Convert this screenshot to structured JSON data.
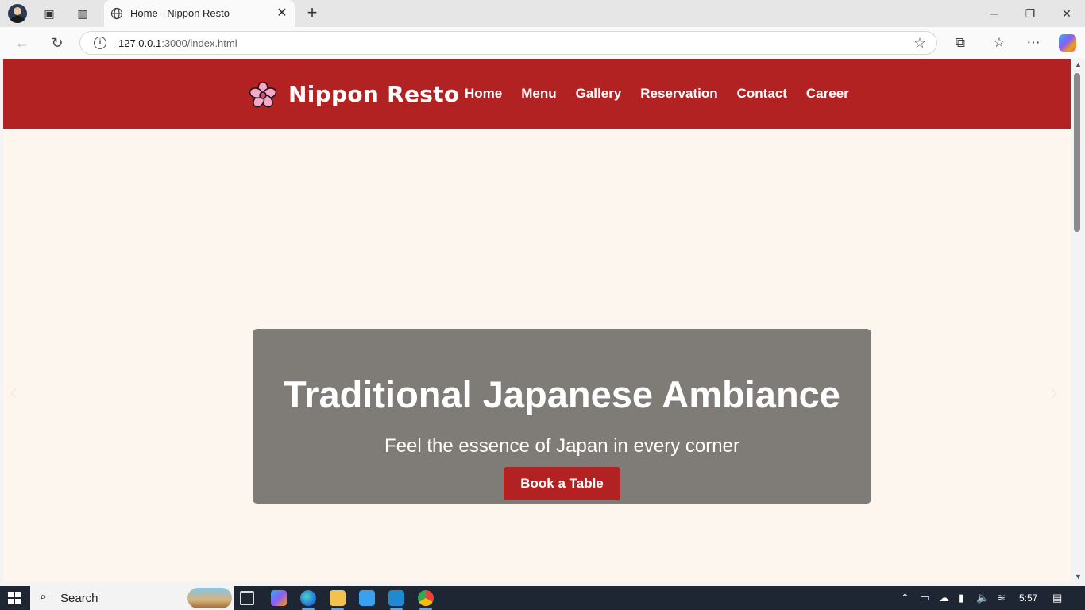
{
  "browser": {
    "tab_title": "Home - Nippon Resto",
    "url_host": "127.0.0.1",
    "url_path": ":3000/index.html"
  },
  "site": {
    "brand_name": "Nippon Resto",
    "nav": [
      "Home",
      "Menu",
      "Gallery",
      "Reservation",
      "Contact",
      "Career"
    ],
    "hero": {
      "title": "Traditional Japanese Ambiance",
      "subtitle": "Feel the essence of Japan in every corner",
      "cta_label": "Book a Table"
    },
    "colors": {
      "brand_red": "#b22222",
      "page_bg": "#fdf6ef",
      "hero_box": "#7f7b77"
    }
  },
  "taskbar": {
    "search_label": "Search",
    "time": "5:57"
  }
}
